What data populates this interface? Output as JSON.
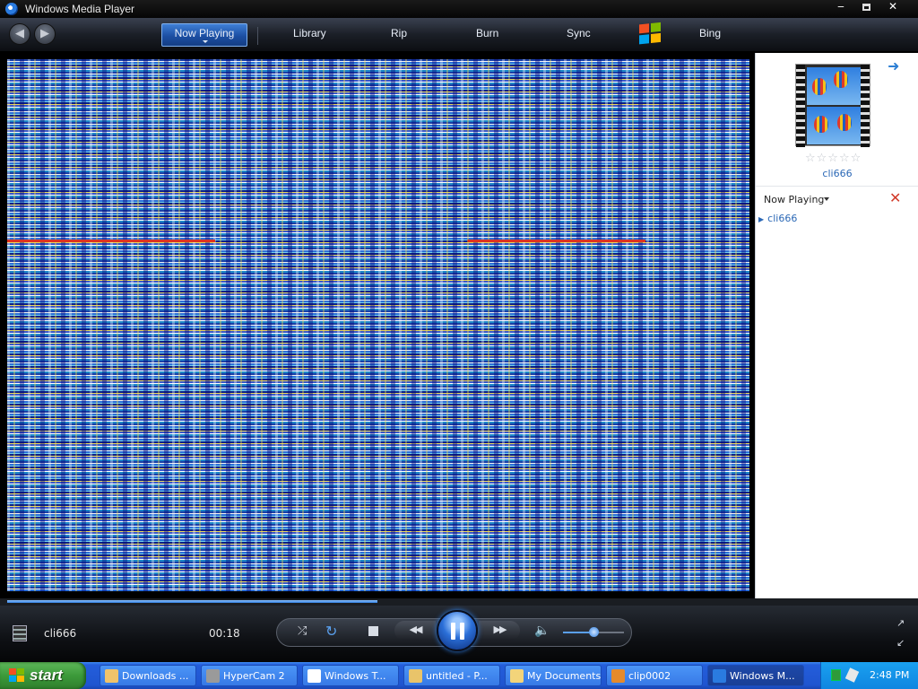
{
  "window": {
    "title": "Windows Media Player",
    "minimize": "‒",
    "close": "✕"
  },
  "nav": {
    "back": "◀",
    "forward": "▶",
    "tabs": [
      {
        "label": "Now Playing",
        "active": true
      },
      {
        "label": "Library"
      },
      {
        "label": "Rip"
      },
      {
        "label": "Burn"
      },
      {
        "label": "Sync"
      },
      {
        "label": "Bing"
      }
    ]
  },
  "side": {
    "forward_arrow": "➜",
    "stars": "☆☆☆☆☆",
    "album_title": "cli666",
    "list_label": "Now Playing",
    "clear_icon": "✕",
    "playlist": [
      {
        "marker": "▶",
        "title": "cli666"
      }
    ]
  },
  "seek": {
    "progress": 0.41
  },
  "player": {
    "media_name": "cli666",
    "time": "00:18",
    "shuffle": "⤮",
    "repeat": "↻",
    "prev": "◀◀",
    "next": "▶▶",
    "mute": "🔈",
    "volume": 0.5,
    "mini_mode": "↗",
    "full_screen": "↙"
  },
  "taskbar": {
    "start_label": "start",
    "tasks": [
      {
        "label": "Downloads ...",
        "icon_color": "#f0c36a"
      },
      {
        "label": "HyperCam 2",
        "icon_color": "#9a9a9a"
      },
      {
        "label": "Windows T...",
        "icon_color": "#ffffff"
      },
      {
        "label": "untitled - P...",
        "icon_color": "#e9c46a"
      },
      {
        "label": "My Documents",
        "icon_color": "#f3d47a"
      },
      {
        "label": "clip0002",
        "icon_color": "#e58a2b"
      },
      {
        "label": "Windows M...",
        "icon_color": "#2a7be0",
        "active": true
      }
    ],
    "clock": "2:48 PM"
  },
  "colors": {
    "accent": "#2d7fe0",
    "taskbar": "#245edb",
    "start": "#3c9a3a"
  }
}
